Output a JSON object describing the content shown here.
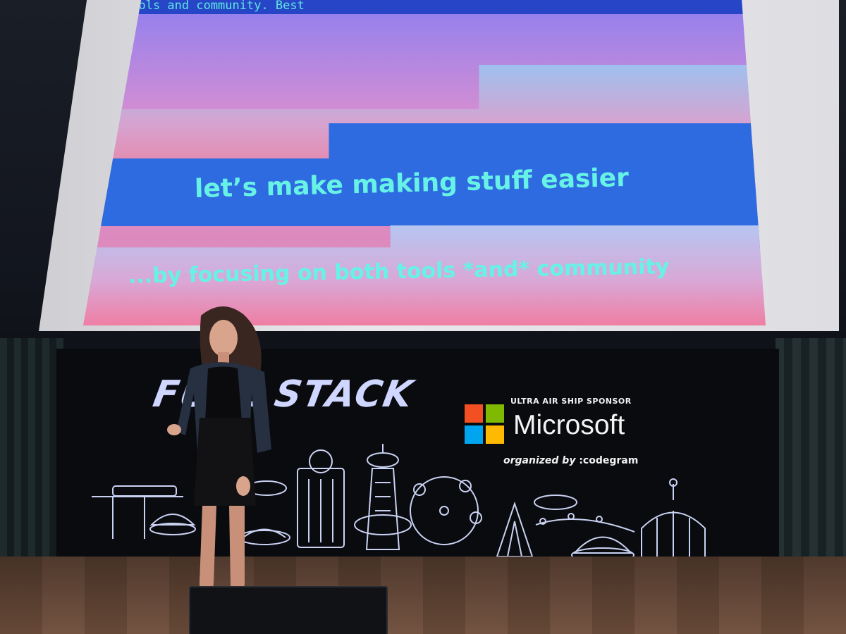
{
  "slide": {
    "top_text": "tools and community. Best",
    "headline": "let’s make making stuff easier",
    "subline": "...by focusing on both tools *and* community"
  },
  "banner": {
    "event_logo": "FULL STACK",
    "sponsor_caption": "ULTRA AIR SHIP SPONSOR",
    "sponsor_name": "Microsoft",
    "organized_by_label": "organized by",
    "organizer_name": ":codegram"
  },
  "colors": {
    "slide_text": "#67f2e6",
    "slide_blue": "#2f6be0",
    "ms_red": "#f25022",
    "ms_green": "#7fba00",
    "ms_blue": "#00a4ef",
    "ms_yellow": "#ffb900"
  }
}
